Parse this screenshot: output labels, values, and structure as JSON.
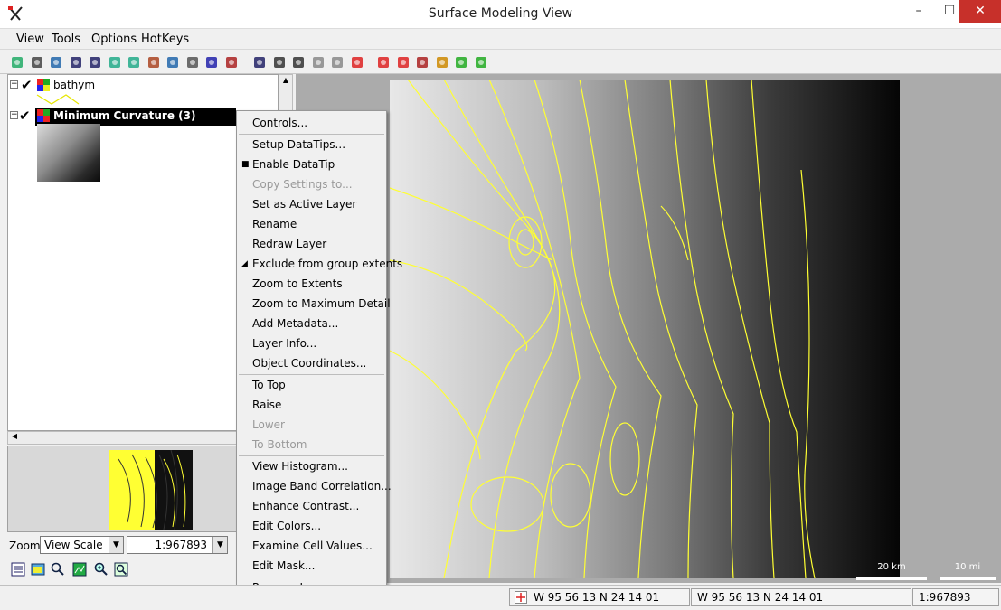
{
  "window": {
    "title": "Surface Modeling View",
    "minimize": "–",
    "maximize": "☐",
    "close": "✕"
  },
  "menu": [
    "View",
    "Tools",
    "Options",
    "HotKeys"
  ],
  "toolbar_icons": [
    "redraw-icon",
    "select-icon",
    "pan-icon",
    "zoom-in-icon",
    "zoom-out-icon",
    "zoom-box-icon",
    "full-extent-icon",
    "globe-icon",
    "layer-icon",
    "camera-icon",
    "add-layer-icon",
    "layer-manager-icon",
    "datatip-icon",
    "measure-icon",
    "query-icon",
    "back-icon",
    "forward-icon",
    "stop-icon",
    "move-icon",
    "zoom-tool-icon",
    "pointer-icon",
    "sketch-icon",
    "legend-icon",
    "chart-icon"
  ],
  "layers": [
    {
      "name": "bathym",
      "checked": "✔",
      "expander": "−"
    },
    {
      "name": "Minimum Curvature (3)",
      "checked": "✔",
      "expander": "−",
      "selected": true
    }
  ],
  "context_menu": {
    "items": [
      {
        "label": "Controls..."
      },
      {
        "sep": true
      },
      {
        "label": "Setup DataTips..."
      },
      {
        "label": "Enable DataTip",
        "check": "■"
      },
      {
        "label": "Copy Settings to...",
        "disabled": true
      },
      {
        "label": "Set as Active Layer"
      },
      {
        "label": "Rename"
      },
      {
        "label": "Redraw Layer"
      },
      {
        "label": "Exclude from group extents",
        "check": "◢"
      },
      {
        "label": "Zoom to Extents"
      },
      {
        "label": "Zoom to Maximum Detail"
      },
      {
        "label": "Add Metadata..."
      },
      {
        "label": "Layer Info..."
      },
      {
        "label": "Object Coordinates..."
      },
      {
        "sep": true
      },
      {
        "label": "To Top"
      },
      {
        "label": "Raise"
      },
      {
        "label": "Lower",
        "disabled": true
      },
      {
        "label": "To Bottom",
        "disabled": true
      },
      {
        "sep": true
      },
      {
        "label": "View Histogram..."
      },
      {
        "label": "Image Band Correlation..."
      },
      {
        "label": "Enhance Contrast..."
      },
      {
        "label": "Edit Colors..."
      },
      {
        "label": "Examine Cell Values..."
      },
      {
        "label": "Edit Mask..."
      },
      {
        "sep": true
      },
      {
        "label": "Remove Layer"
      }
    ]
  },
  "zoom": {
    "label": "Zoom",
    "mode": "View Scale",
    "scale": "1:967893",
    "arrow": "▼"
  },
  "scalebars": {
    "km": "20 km",
    "mi": "10 mi"
  },
  "status": {
    "coord1": "W 95 56 13  N 24 14 01",
    "coord2": "W 95 56 13  N 24 14 01",
    "scale": "1:967893"
  },
  "colors": {
    "contour": "#ffff33",
    "selection": "#000000",
    "close": "#c7302a"
  }
}
